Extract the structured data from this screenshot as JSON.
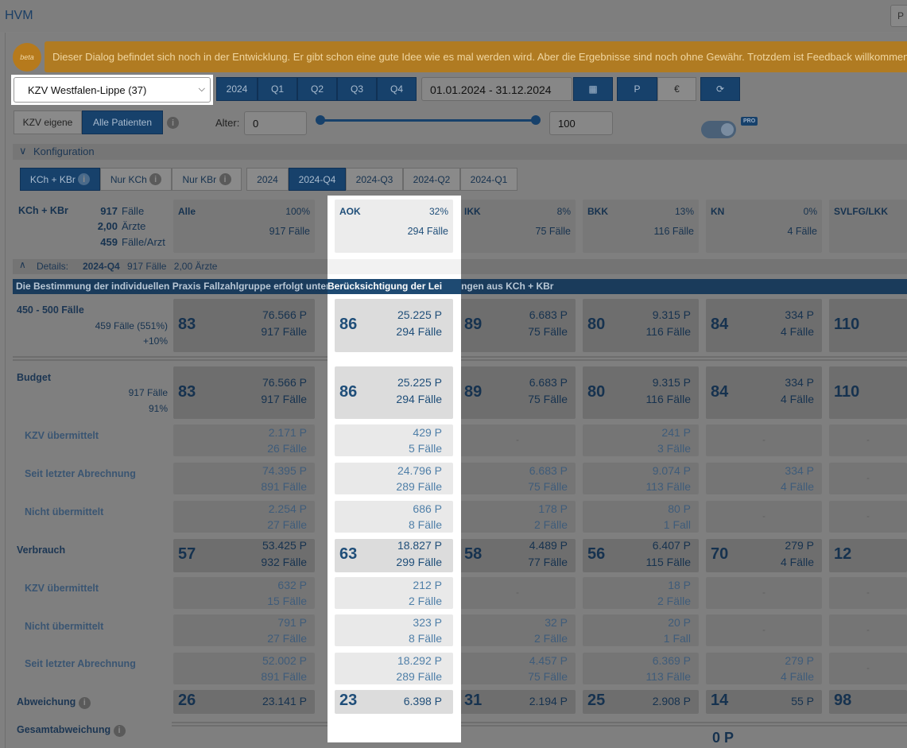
{
  "app": {
    "title": "HVM",
    "top_right_button": "P"
  },
  "banner": {
    "badge": "beta",
    "text": "Dieser Dialog befindet sich noch in der Entwicklung. Er gibt schon eine gute Idee wie es mal werden wird. Aber die Ergebnisse sind noch ohne Gewähr. Trotzdem ist Feedback willkommen."
  },
  "toolbar": {
    "kzv_select": "KZV Westfalen-Lippe (37)",
    "periods": [
      "2024",
      "Q1",
      "Q2",
      "Q3",
      "Q4"
    ],
    "date_range": "01.01.2024 - 31.12.2024",
    "unit_p": "P",
    "unit_eur": "€",
    "patient_filter": [
      "KZV eigene",
      "Alle Patienten"
    ],
    "age_label": "Alter:",
    "age_min": "0",
    "age_max": "100",
    "pro": "PRO"
  },
  "config": {
    "label": "Konfiguration",
    "leistung_tabs": [
      "KCh + KBr",
      "Nur KCh",
      "Nur KBr"
    ],
    "quarter_tabs": [
      "2024",
      "2024-Q4",
      "2024-Q3",
      "2024-Q2",
      "2024-Q1"
    ]
  },
  "summary": {
    "label": "KCh + KBr",
    "faelle": "917",
    "faelle_lbl": "Fälle",
    "aerzte": "2,00",
    "aerzte_lbl": "Ärzte",
    "pro_arzt": "459",
    "pro_arzt_lbl": "Fälle/Arzt"
  },
  "kassen": [
    {
      "name": "Alle",
      "pct": "100%",
      "faelle": "917 Fälle"
    },
    {
      "name": "AOK",
      "pct": "32%",
      "faelle": "294 Fälle"
    },
    {
      "name": "IKK",
      "pct": "8%",
      "faelle": "75 Fälle"
    },
    {
      "name": "BKK",
      "pct": "13%",
      "faelle": "116 Fälle"
    },
    {
      "name": "KN",
      "pct": "0%",
      "faelle": "4 Fälle"
    },
    {
      "name": "SVLFG/LKK",
      "pct": "",
      "faelle": ""
    }
  ],
  "details": {
    "label": "Details:",
    "quarter": "2024-Q4",
    "faelle": "917 Fälle",
    "aerzte": "2,00 Ärzte"
  },
  "info_text": "Die Bestimmung der individuellen Praxis Fallzahlgruppe erfolgt unter Berücksichtigung der Leistungen aus KCh + KBr",
  "group": {
    "title": "450 - 500 Fälle",
    "sub1": "459 Fälle (551%)",
    "sub2": "+10%",
    "cells": [
      [
        "83",
        "76.566 P",
        "917 Fälle"
      ],
      [
        "86",
        "25.225 P",
        "294 Fälle"
      ],
      [
        "89",
        "6.683 P",
        "75 Fälle"
      ],
      [
        "80",
        "9.315 P",
        "116 Fälle"
      ],
      [
        "84",
        "334 P",
        "4 Fälle"
      ],
      [
        "110",
        "",
        ""
      ]
    ]
  },
  "budget": {
    "title": "Budget",
    "sub1": "917 Fälle",
    "sub2": "91%",
    "cells": [
      [
        "83",
        "76.566 P",
        "917 Fälle"
      ],
      [
        "86",
        "25.225 P",
        "294 Fälle"
      ],
      [
        "89",
        "6.683 P",
        "75 Fälle"
      ],
      [
        "80",
        "9.315 P",
        "116 Fälle"
      ],
      [
        "84",
        "334 P",
        "4 Fälle"
      ],
      [
        "110",
        "",
        ""
      ]
    ]
  },
  "budget_rows": [
    {
      "label": "KZV übermittelt",
      "cells": [
        [
          "2.171 P",
          "26 Fälle"
        ],
        [
          "429 P",
          "5 Fälle"
        ],
        [
          "-",
          ""
        ],
        [
          "241 P",
          "3 Fälle"
        ],
        [
          "-",
          ""
        ],
        [
          "-",
          ""
        ]
      ]
    },
    {
      "label": "Seit letzter Abrechnung",
      "cells": [
        [
          "74.395 P",
          "891 Fälle"
        ],
        [
          "24.796 P",
          "289 Fälle"
        ],
        [
          "6.683 P",
          "75 Fälle"
        ],
        [
          "9.074 P",
          "113 Fälle"
        ],
        [
          "334 P",
          "4 Fälle"
        ],
        [
          "-",
          ""
        ]
      ]
    },
    {
      "label": "Nicht übermittelt",
      "cells": [
        [
          "2.254 P",
          "27 Fälle"
        ],
        [
          "686 P",
          "8 Fälle"
        ],
        [
          "178 P",
          "2 Fälle"
        ],
        [
          "80 P",
          "1 Fall"
        ],
        [
          "-",
          ""
        ],
        [
          "-",
          ""
        ]
      ]
    }
  ],
  "verbrauch": {
    "title": "Verbrauch",
    "cells": [
      [
        "57",
        "53.425 P",
        "932 Fälle"
      ],
      [
        "63",
        "18.827 P",
        "299 Fälle"
      ],
      [
        "58",
        "4.489 P",
        "77 Fälle"
      ],
      [
        "56",
        "6.407 P",
        "115 Fälle"
      ],
      [
        "70",
        "279 P",
        "4 Fälle"
      ],
      [
        "12",
        "",
        ""
      ]
    ]
  },
  "verbrauch_rows": [
    {
      "label": "KZV übermittelt",
      "cells": [
        [
          "632 P",
          "15 Fälle"
        ],
        [
          "212 P",
          "2 Fälle"
        ],
        [
          "-",
          ""
        ],
        [
          "18 P",
          "2 Fälle"
        ],
        [
          "-",
          ""
        ],
        [
          "-",
          ""
        ]
      ]
    },
    {
      "label": "Nicht übermittelt",
      "cells": [
        [
          "791 P",
          "27 Fälle"
        ],
        [
          "323 P",
          "8 Fälle"
        ],
        [
          "32 P",
          "2 Fälle"
        ],
        [
          "20 P",
          "1 Fall"
        ],
        [
          "-",
          ""
        ],
        [
          "-",
          ""
        ]
      ]
    },
    {
      "label": "Seit letzter Abrechnung",
      "cells": [
        [
          "52.002 P",
          "891 Fälle"
        ],
        [
          "18.292 P",
          "289 Fälle"
        ],
        [
          "4.457 P",
          "75 Fälle"
        ],
        [
          "6.369 P",
          "113 Fälle"
        ],
        [
          "279 P",
          "4 Fälle"
        ],
        [
          "-",
          ""
        ]
      ]
    }
  ],
  "abweichung": {
    "title": "Abweichung",
    "cells": [
      [
        "26",
        "23.141 P"
      ],
      [
        "23",
        "6.398 P"
      ],
      [
        "31",
        "2.194 P"
      ],
      [
        "25",
        "2.908 P"
      ],
      [
        "14",
        "55 P"
      ],
      [
        "98",
        ""
      ]
    ]
  },
  "gesamt": {
    "title": "Gesamtabweichung",
    "value": "0 P"
  }
}
